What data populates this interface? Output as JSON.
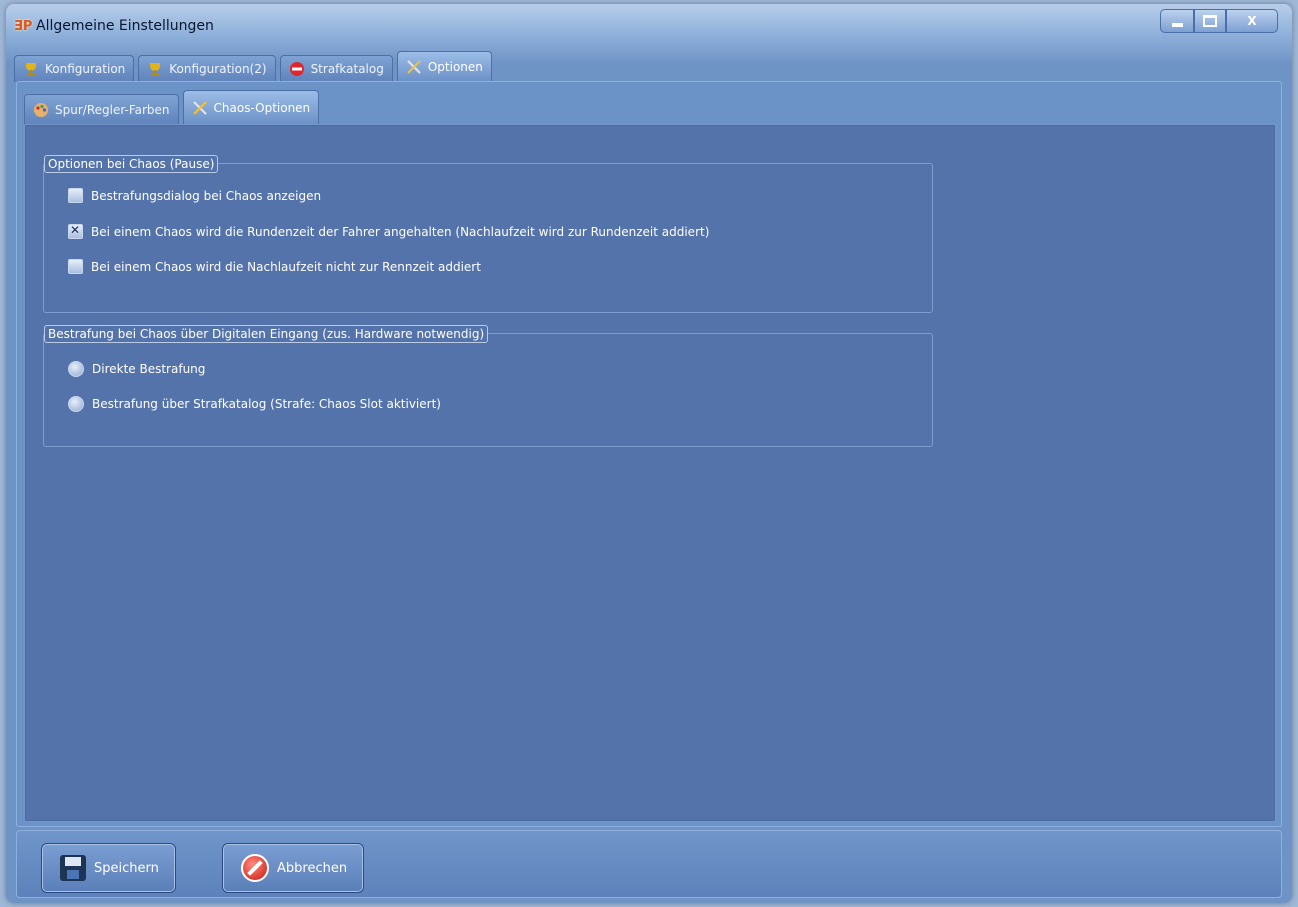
{
  "window": {
    "title": "Allgemeine Einstellungen",
    "controls": {
      "minimize": "minimize",
      "maximize": "maximize",
      "close": "X"
    }
  },
  "outer_tabs": [
    {
      "label": "Konfiguration",
      "icon": "trophy-icon",
      "active": false
    },
    {
      "label": "Konfiguration(2)",
      "icon": "trophy-icon",
      "active": false
    },
    {
      "label": "Strafkatalog",
      "icon": "no-entry-icon",
      "active": false
    },
    {
      "label": "Optionen",
      "icon": "tools-icon",
      "active": true
    }
  ],
  "inner_tabs": [
    {
      "label": "Spur/Regler-Farben",
      "icon": "palette-icon",
      "active": false
    },
    {
      "label": "Chaos-Optionen",
      "icon": "tools-icon",
      "active": true
    }
  ],
  "group_pause": {
    "legend": "Optionen bei Chaos (Pause)",
    "options": [
      {
        "label": "Bestrafungsdialog bei Chaos anzeigen",
        "checked": false
      },
      {
        "label": "Bei einem Chaos wird die Rundenzeit der Fahrer angehalten (Nachlaufzeit wird zur Rundenzeit addiert)",
        "checked": true
      },
      {
        "label": "Bei einem Chaos wird die Nachlaufzeit nicht zur Rennzeit addiert",
        "checked": false
      }
    ]
  },
  "group_digital": {
    "legend": "Bestrafung bei Chaos über Digitalen Eingang (zus. Hardware notwendig)",
    "options": [
      {
        "label": "Direkte Bestrafung",
        "selected": false
      },
      {
        "label": "Bestrafung über Strafkatalog (Strafe: Chaos Slot aktiviert)",
        "selected": false
      }
    ]
  },
  "buttons": {
    "save": "Speichern",
    "cancel": "Abbrechen"
  },
  "colors": {
    "panel_bg": "#5573ab",
    "frame_bg": "#6c93c8",
    "text": "#ffffff",
    "title_text": "#0a1530"
  }
}
